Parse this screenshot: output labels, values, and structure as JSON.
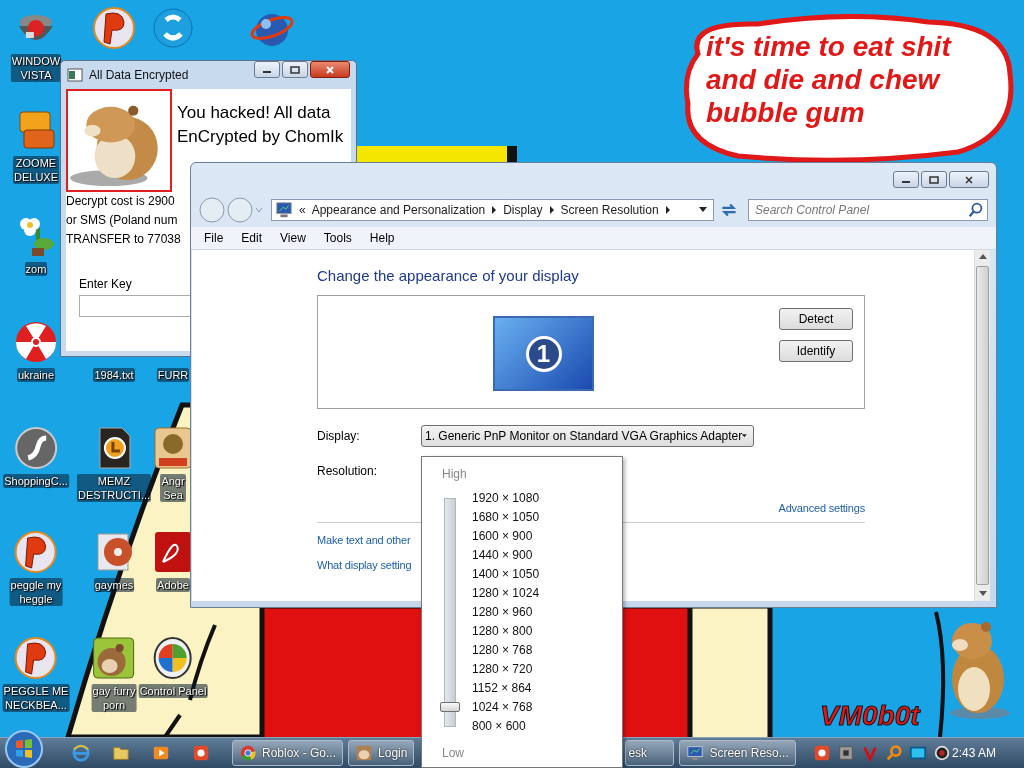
{
  "desktop": {
    "icon_columns": [
      [
        {
          "label": "WINDOW\nVISTA",
          "kind": "orb"
        },
        {
          "label": "ZOOME\nDELUXE",
          "kind": "blocks"
        },
        {
          "label": "zom",
          "kind": "flower"
        },
        {
          "label": "ukraine",
          "kind": "radiation"
        },
        {
          "label": "ShoppingC...",
          "kind": "flash"
        },
        {
          "label": "peggle my\nheggle",
          "kind": "ball"
        },
        {
          "label": "PEGGLE ME\nNECKBEA...",
          "kind": "ball"
        }
      ],
      [
        {
          "kind": "ball"
        },
        null,
        null,
        {
          "label": "1984.txt"
        },
        {
          "label": "MEMZ\nDESTRUCTI...",
          "kind": "document"
        },
        {
          "label": "gaymes",
          "kind": "disc"
        },
        {
          "label": "gay furry\nporn",
          "kind": "box"
        }
      ],
      [
        {
          "kind": "bubble"
        },
        null,
        null,
        {
          "label": "FURR"
        },
        {
          "label": "Angr\nSea",
          "kind": "game"
        },
        {
          "label": "Adobe",
          "kind": "acrobat"
        },
        {
          "label": "Control Panel",
          "kind": "control"
        }
      ],
      [
        {
          "kind": "globe"
        }
      ]
    ],
    "bubble_text": "it's time to eat shit and die and chew bubble gum",
    "signature": "VM0b0t"
  },
  "ransom_window": {
    "title": "All Data Encrypted",
    "headline": "You hacked! All data EnCrypted by ChomIk",
    "message_lines": [
      "Decrypt cost is 2900",
      "or SMS (Poland num",
      "TRANSFER to 77038"
    ],
    "key_label": "Enter Key"
  },
  "control_panel": {
    "breadcrumb_prefix": "«",
    "breadcrumbs": [
      "Appearance and Personalization",
      "Display",
      "Screen Resolution"
    ],
    "search": {
      "placeholder": "Search Control Panel"
    },
    "menu": [
      "File",
      "Edit",
      "View",
      "Tools",
      "Help"
    ],
    "heading": "Change the appearance of your display",
    "display_number": "1",
    "buttons": [
      "Detect",
      "Identify"
    ],
    "display_label": "Display:",
    "display_value": "1. Generic PnP Monitor on Standard VGA Graphics Adapter",
    "resolution_label": "Resolution:",
    "advanced_link": "Advanced settings",
    "links": [
      "Make text and other",
      "What display setting"
    ]
  },
  "resolution_popup": {
    "high": "High",
    "low": "Low",
    "level": 0.083,
    "options": [
      "1920 × 1080",
      "1680 × 1050",
      "1600 × 900",
      "1440 × 900",
      "1400 × 1050",
      "1280 × 1024",
      "1280 × 960",
      "1280 × 800",
      "1280 × 768",
      "1280 × 720",
      "1152 × 864",
      "1024 × 768",
      "800 × 600"
    ]
  },
  "taskbar": {
    "quick_launch": [
      {
        "kind": "browser"
      },
      {
        "kind": "folder"
      },
      {
        "kind": "player"
      },
      {
        "kind": "app"
      }
    ],
    "tasks": [
      {
        "label": "Roblox - Go...",
        "kind": "chrome"
      },
      {
        "label": "Login",
        "kind": "hamster"
      },
      {
        "label": "esk"
      },
      {
        "label": "Screen Reso...",
        "kind": "monitor"
      }
    ],
    "tray": [
      {
        "kind": "app"
      },
      {
        "kind": "chip"
      },
      {
        "kind": "chevron"
      },
      {
        "kind": "magnifier"
      },
      {
        "kind": "screen"
      },
      {
        "kind": "speaker"
      }
    ],
    "clock": "2:43 AM"
  }
}
